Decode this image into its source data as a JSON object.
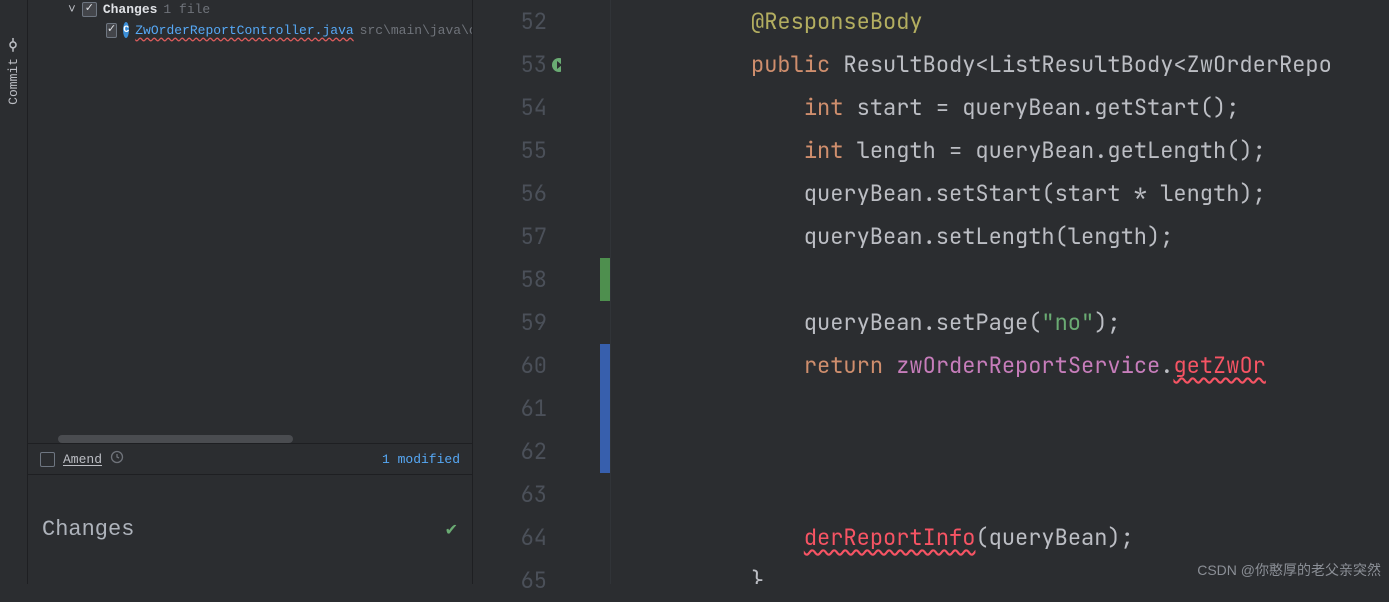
{
  "sidebar": {
    "commit_tab": "Commit"
  },
  "commit_panel": {
    "changes_label": "Changes",
    "changes_count": "1 file",
    "file": {
      "icon_letter": "C",
      "name": "ZwOrderReportController.java",
      "path": "src\\main\\java\\co"
    },
    "amend_label": "Amend",
    "modified_label": "1 modified",
    "message_placeholder": "Changes"
  },
  "editor": {
    "lines": [
      {
        "num": "52",
        "tokens": [
          {
            "t": "          ",
            "c": ""
          },
          {
            "t": "@ResponseBody",
            "c": "anno"
          }
        ]
      },
      {
        "num": "53",
        "run_icon": true,
        "at_icon": "@",
        "tokens": [
          {
            "t": "          ",
            "c": ""
          },
          {
            "t": "public",
            "c": "kw"
          },
          {
            "t": " ",
            "c": ""
          },
          {
            "t": "ResultBody<ListResultBody<ZwOrderRepo",
            "c": "type"
          }
        ]
      },
      {
        "num": "54",
        "tokens": [
          {
            "t": "              ",
            "c": ""
          },
          {
            "t": "int",
            "c": "kw"
          },
          {
            "t": " start = queryBean.getStart();",
            "c": "ident"
          }
        ]
      },
      {
        "num": "55",
        "tokens": [
          {
            "t": "              ",
            "c": ""
          },
          {
            "t": "int",
            "c": "kw"
          },
          {
            "t": " length = queryBean.getLength();",
            "c": "ident"
          }
        ]
      },
      {
        "num": "56",
        "tokens": [
          {
            "t": "              queryBean.setStart(start * length);",
            "c": "ident"
          }
        ]
      },
      {
        "num": "57",
        "tokens": [
          {
            "t": "              queryBean.setLength(length);",
            "c": "ident"
          }
        ]
      },
      {
        "num": "58",
        "mark": "add",
        "tokens": [
          {
            "t": "",
            "c": ""
          }
        ]
      },
      {
        "num": "59",
        "tokens": [
          {
            "t": "              queryBean.setPage(",
            "c": "ident"
          },
          {
            "t": "\"no\"",
            "c": "str"
          },
          {
            "t": ");",
            "c": "ident"
          }
        ]
      },
      {
        "num": "60",
        "mark": "mod",
        "tokens": [
          {
            "t": "              ",
            "c": ""
          },
          {
            "t": "return",
            "c": "kw"
          },
          {
            "t": " ",
            "c": ""
          },
          {
            "t": "zwOrderReportService",
            "c": "call-hl"
          },
          {
            "t": ".",
            "c": "ident"
          },
          {
            "t": "getZwOr",
            "c": "err"
          }
        ]
      },
      {
        "num": "61",
        "mark": "mod",
        "tokens": [
          {
            "t": "",
            "c": ""
          }
        ]
      },
      {
        "num": "62",
        "mark": "mod",
        "tokens": [
          {
            "t": "",
            "c": ""
          }
        ]
      },
      {
        "num": "63",
        "tokens": [
          {
            "t": "",
            "c": ""
          }
        ]
      },
      {
        "num": "64",
        "tokens": [
          {
            "t": "              ",
            "c": ""
          },
          {
            "t": "derReportInfo",
            "c": "err"
          },
          {
            "t": "(queryBean);",
            "c": "ident"
          }
        ]
      },
      {
        "num": "65",
        "tokens": [
          {
            "t": "          }",
            "c": "ident"
          }
        ]
      }
    ],
    "marks": {
      "add_color": "#4e8f4e",
      "mod_color": "#375fad"
    }
  },
  "watermark": "CSDN @你憨厚的老父亲突然"
}
